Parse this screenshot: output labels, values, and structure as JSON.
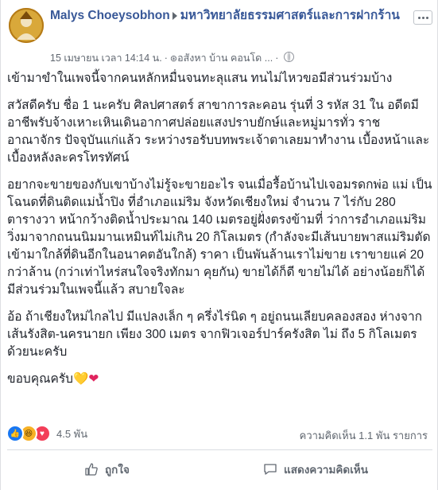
{
  "post": {
    "author": "Malys Choeysobhon",
    "group": "มหาวิทยาลัยธรรมศาสตร์และการฝากร้าน",
    "timestamp": "15 เมษายน เวลา 14:14 น.",
    "location": "อสังหา บ้าน คอนโด ...",
    "body": [
      "เข้ามาขำในเพจนี้จากคนหลักหมื่นจนทะลุแสน ทนไม่ไหวขอมีส่วนร่วมบ้าง",
      "สวัสดีครับ ชื่อ 1 นะครับ ศิลปศาสตร์ สาขาการละคอน รุ่นที่ 3 รหัส 31 ใน อดีตมีอาชีพรับจ้างเหาะเหินเดินอากาศปล่อยแสงปราบยักษ์และหมู่มารทั่ว ราชอาณาจักร ปัจจุบันแก่แล้ว ระหว่างรอรับบทพระเจ้าตาเลยมาทำงาน เบื้องหน้าและเบื้องหลังละครโทรทัศน์",
      "อยากจะขายของกับเขาบ้างไม่รู้จะขายอะไร จนเมื่อรื้อบ้านไปเจอมรดกพ่อ แม่ เป็นโฉนดที่ดินติดแม่น้ำปิง ที่อำเภอแม่ริม จังหวัดเชียงใหม่ จำนวน 7 ไร่กับ 280 ตารางวา หน้ากว้างติดน้ำประมาณ 140 เมตรอยู่ฝั่งตรงข้ามที่ ว่าการอำเภอแม่ริม วิ่งมาจากถนนนิมมานเหมินท์ไม่เกิน 20 กิโลเมตร (กำลังจะมีเส้นบายพาสแม่ริมตัดเข้ามาใกล้ที่ดินอีกในอนาคตอันใกล้) ราคา เป็นพันล้านเราไม่ขาย เราขายแค่ 20 กว่าล้าน (กว่าเท่าไหร่สนใจจริงทักมา คุยกัน) ขายได้ก็ดี ขายไม่ได้ อย่างน้อยก็ได้มีส่วนร่วมในเพจนี้แล้ว สบายใจละ",
      "อ้อ ถ้าเชียงใหม่ไกลไป มีแปลงเล็ก ๆ ครึ่งไร่นิด ๆ อยู่ถนนเลียบคลองสอง ห่างจากเส้นรังสิต-นครนายก เพียง 300 เมตร จากฟิวเจอร์ปาร์ครังสิต ไม่ ถึง 5 กิโลเมตรด้วยนะครับ",
      "ขอบคุณครับ"
    ],
    "emoji": [
      "💛",
      "❤"
    ]
  },
  "stats": {
    "reactions": "4.5 พัน",
    "comments_shares": "ความคิดเห็น 1.1 พัน รายการ"
  },
  "actions": {
    "like": "ถูกใจ",
    "comment": "แสดงความคิดเห็น"
  },
  "colors": {
    "link": "#385898",
    "muted": "#606770",
    "like": "#1877f2",
    "love": "#f33e58",
    "haha": "#f7b125"
  }
}
